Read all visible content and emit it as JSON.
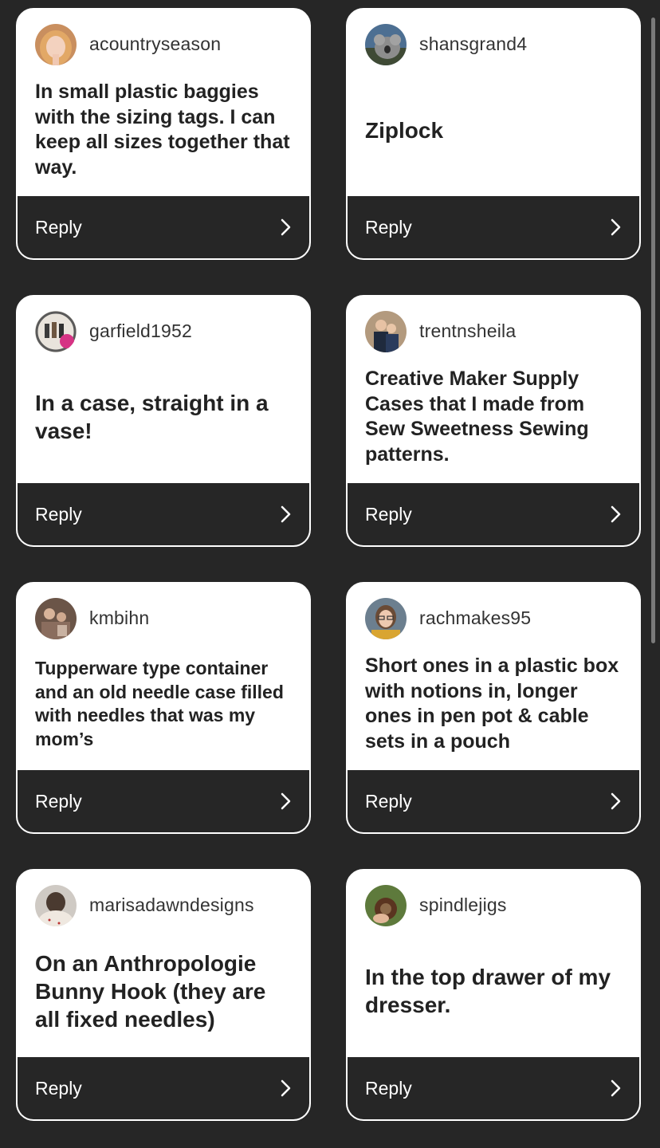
{
  "reply_label": "Reply",
  "cards": [
    {
      "username": "acountryseason",
      "comment": "In small plastic baggies with the sizing tags. I can keep all sizes together that way.",
      "avatar_icon": "profile-photo-blonde-woman"
    },
    {
      "username": "shansgrand4",
      "comment": "Ziplock",
      "avatar_icon": "profile-photo-koala"
    },
    {
      "username": "garfield1952",
      "comment": "In a case, straight in a vase!",
      "avatar_icon": "profile-photo-group-logo"
    },
    {
      "username": "trentnsheila",
      "comment": "Creative Maker Supply Cases that I made from Sew Sweetness Sewing patterns.",
      "avatar_icon": "profile-photo-couple"
    },
    {
      "username": "kmbihn",
      "comment": "Tupperware type container and an old needle case filled with needles that was my mom’s",
      "avatar_icon": "profile-photo-family"
    },
    {
      "username": "rachmakes95",
      "comment": "Short ones in a plastic box with notions in, longer ones in pen pot & cable sets in a pouch",
      "avatar_icon": "profile-photo-woman-glasses"
    },
    {
      "username": "marisadawndesigns",
      "comment": "On an Anthropologie Bunny Hook (they are all fixed needles)",
      "avatar_icon": "profile-photo-hair-back"
    },
    {
      "username": "spindlejigs",
      "comment": "In the top drawer of my dresser.",
      "avatar_icon": "profile-photo-spindle"
    }
  ],
  "colors": {
    "background": "#262626",
    "card": "#ffffff",
    "reply_bar": "#262626",
    "text": "#222222"
  }
}
